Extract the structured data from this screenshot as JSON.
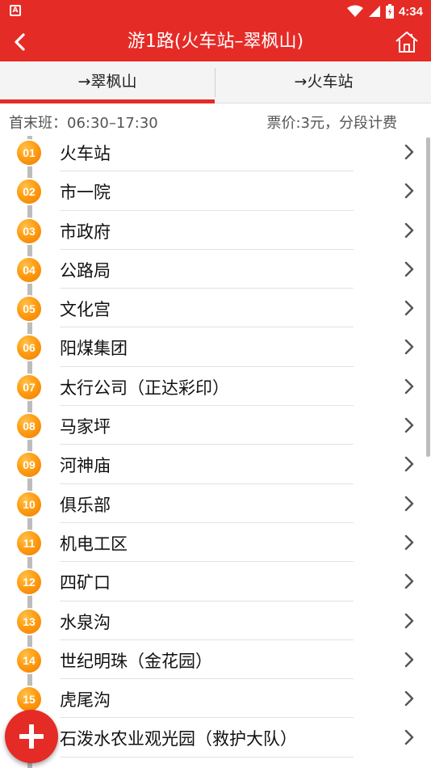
{
  "status_bar": {
    "time": "4:34",
    "notification_badge": "A",
    "icons": [
      "wifi-icon",
      "signal-icon",
      "battery-icon"
    ]
  },
  "header": {
    "title": "游1路(火车站–翠枫山)",
    "back_icon": "back-arrow-icon",
    "home_icon": "home-icon"
  },
  "tabs": [
    {
      "label": "→翠枫山",
      "active": true
    },
    {
      "label": "→火车站",
      "active": false
    }
  ],
  "info": {
    "first_last": "首末班：06:30–17:30",
    "fare": "票价:3元，分段计费"
  },
  "stations": [
    {
      "no": "01",
      "name": "火车站"
    },
    {
      "no": "02",
      "name": "市一院"
    },
    {
      "no": "03",
      "name": "市政府"
    },
    {
      "no": "04",
      "name": "公路局"
    },
    {
      "no": "05",
      "name": "文化宫"
    },
    {
      "no": "06",
      "name": "阳煤集团"
    },
    {
      "no": "07",
      "name": "太行公司（正达彩印）"
    },
    {
      "no": "08",
      "name": "马家坪"
    },
    {
      "no": "09",
      "name": "河神庙"
    },
    {
      "no": "10",
      "name": "俱乐部"
    },
    {
      "no": "11",
      "name": "机电工区"
    },
    {
      "no": "12",
      "name": "四矿口"
    },
    {
      "no": "13",
      "name": "水泉沟"
    },
    {
      "no": "14",
      "name": "世纪明珠（金花园）"
    },
    {
      "no": "15",
      "name": "虎尾沟"
    },
    {
      "no": "16",
      "name": "石泼水农业观光园（救护大队）"
    }
  ],
  "colors": {
    "brand_red": "#e52b26",
    "badge_orange": "#ff9d13"
  },
  "fab": {
    "icon": "plus-icon"
  }
}
